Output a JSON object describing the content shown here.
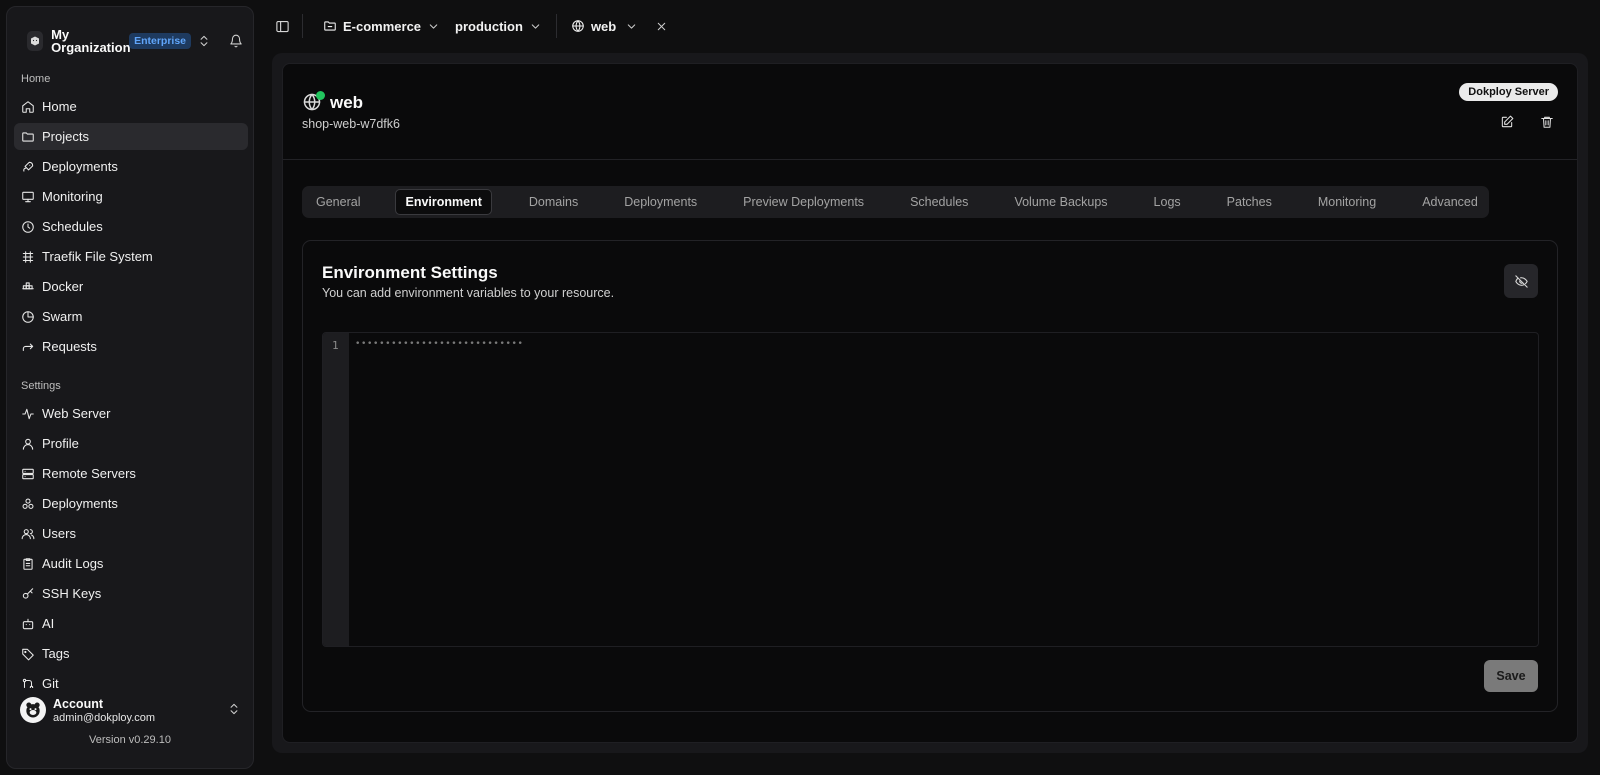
{
  "org": {
    "name": "My Organization",
    "badge": "Enterprise"
  },
  "sidebar": {
    "home_section": "Home",
    "home_items": [
      {
        "label": "Home",
        "icon": "home-icon"
      },
      {
        "label": "Projects",
        "icon": "folder-icon",
        "active": true
      },
      {
        "label": "Deployments",
        "icon": "rocket-icon"
      },
      {
        "label": "Monitoring",
        "icon": "monitor-icon"
      },
      {
        "label": "Schedules",
        "icon": "clock-icon"
      },
      {
        "label": "Traefik File System",
        "icon": "traefik-icon"
      },
      {
        "label": "Docker",
        "icon": "docker-icon"
      },
      {
        "label": "Swarm",
        "icon": "swarm-icon"
      },
      {
        "label": "Requests",
        "icon": "requests-icon"
      }
    ],
    "settings_section": "Settings",
    "settings_items": [
      {
        "label": "Web Server",
        "icon": "activity-icon"
      },
      {
        "label": "Profile",
        "icon": "user-icon"
      },
      {
        "label": "Remote Servers",
        "icon": "server-icon"
      },
      {
        "label": "Deployments",
        "icon": "boxes-icon"
      },
      {
        "label": "Users",
        "icon": "users-icon"
      },
      {
        "label": "Audit Logs",
        "icon": "clipboard-icon"
      },
      {
        "label": "SSH Keys",
        "icon": "key-icon"
      },
      {
        "label": "AI",
        "icon": "bot-icon"
      },
      {
        "label": "Tags",
        "icon": "tag-icon"
      },
      {
        "label": "Git",
        "icon": "git-icon"
      }
    ],
    "account": {
      "name": "Account",
      "email": "admin@dokploy.com"
    },
    "version": "Version v0.29.10"
  },
  "topbar": {
    "project": "E-commerce",
    "environment": "production",
    "service": "web"
  },
  "service": {
    "name": "web",
    "app_name": "shop-web-w7dfk6",
    "server_badge": "Dokploy Server",
    "status_color": "#22c55e"
  },
  "tabs": [
    {
      "label": "General"
    },
    {
      "label": "Environment",
      "active": true
    },
    {
      "label": "Domains"
    },
    {
      "label": "Deployments"
    },
    {
      "label": "Preview Deployments"
    },
    {
      "label": "Schedules"
    },
    {
      "label": "Volume Backups"
    },
    {
      "label": "Logs"
    },
    {
      "label": "Patches"
    },
    {
      "label": "Monitoring"
    },
    {
      "label": "Advanced"
    }
  ],
  "environment": {
    "title": "Environment Settings",
    "description": "You can add environment variables to your resource.",
    "line_number": "1",
    "masked_value": "••••••••••••••••••••••••••••",
    "save_label": "Save"
  }
}
